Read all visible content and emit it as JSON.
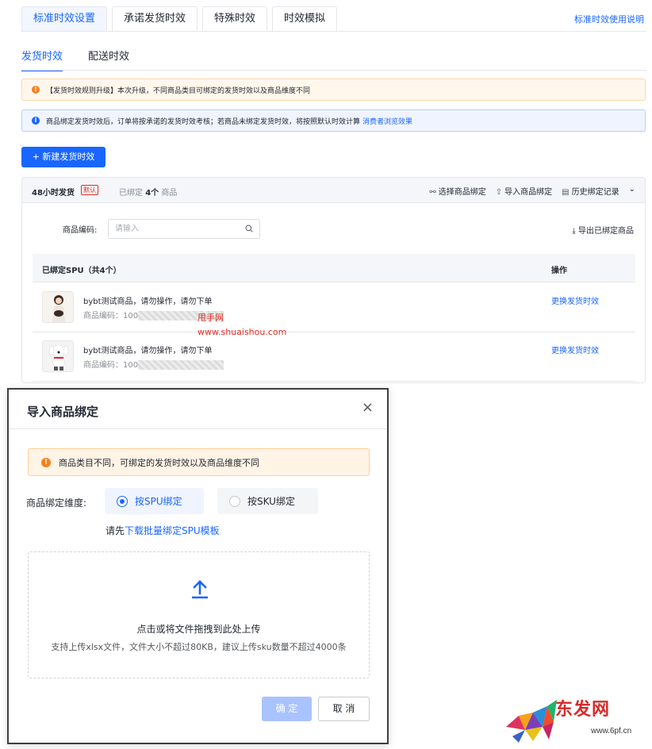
{
  "top_tabs": [
    {
      "label": "标准时效设置",
      "active": true
    },
    {
      "label": "承诺发货时效",
      "active": false
    },
    {
      "label": "特殊时效",
      "active": false
    },
    {
      "label": "时效模拟",
      "active": false
    }
  ],
  "help_link": "标准时效使用说明",
  "sub_tabs": [
    {
      "label": "发货时效",
      "active": true
    },
    {
      "label": "配送时效",
      "active": false
    }
  ],
  "alerts": {
    "warn_text": "【发货时效规则升级】本次升级，不同商品类目可绑定的发货时效以及商品维度不同",
    "info_text": "商品绑定发货时效后，订单将按承诺的发货时效考核；若商品未绑定发货时效，将按照默认时效计算",
    "info_link": "消费者浏览效果"
  },
  "new_button": "+ 新建发货时效",
  "card": {
    "title": "48小时发货",
    "default_tag": "默认",
    "bound_prefix": "已绑定",
    "bound_count": "4个",
    "bound_suffix": "商品",
    "actions": [
      "选择商品绑定",
      "导入商品绑定",
      "历史绑定记录"
    ],
    "code_label": "商品编码:",
    "code_placeholder": "请输入",
    "export_link": "导出已绑定商品",
    "table": {
      "col_spu": "已绑定SPU（共4个）",
      "col_action": "操作",
      "rows": [
        {
          "name": "bybt测试商品，请勿操作，请勿下单",
          "code_label": "商品编码：",
          "code_visible": "100",
          "action": "更换发货时效"
        },
        {
          "name": "bybt测试商品，请勿操作，请勿下单",
          "code_label": "商品编码：",
          "code_visible": "100",
          "action": "更换发货时效"
        }
      ]
    }
  },
  "watermark": {
    "cn": "甩手网",
    "url": "www.shuaishou.com"
  },
  "modal": {
    "title": "导入商品绑定",
    "close": "×",
    "alert": "商品类目不同，可绑定的发货时效以及商品维度不同",
    "dimension_label": "商品绑定维度:",
    "option_spu": "按SPU绑定",
    "option_sku": "按SKU绑定",
    "selected": "spu",
    "template_prefix": "请先",
    "template_link": "下载批量绑定SPU模板",
    "upload_main": "点击或将文件拖拽到此处上传",
    "upload_sub": "支持上传xlsx文件，文件大小不超过80KB，建议上传sku数量不超过4000条",
    "ok": "确 定",
    "cancel": "取 消"
  },
  "logo": {
    "text": "东发网",
    "url": "www.6pf.cn"
  },
  "colors": {
    "primary": "#1966ff",
    "warning": "#f5811f",
    "danger": "#e02e24",
    "disabled_primary": "#a9c3ff"
  }
}
